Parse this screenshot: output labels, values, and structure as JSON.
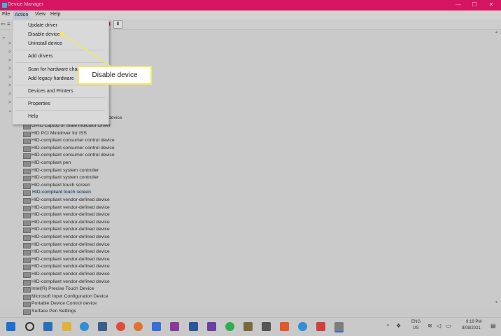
{
  "window": {
    "title": "Device Manager",
    "controls": [
      "—",
      "☐",
      "✕"
    ]
  },
  "menubar": [
    "File",
    "Action",
    "View",
    "Help"
  ],
  "action_menu": {
    "items": [
      "Update driver",
      "Disable device",
      "Uninstall device",
      "Add drivers",
      "Scan for hardware changes",
      "Add legacy hardware",
      "Devices and Printers",
      "Properties",
      "Help"
    ]
  },
  "callout": {
    "text": "Disable device"
  },
  "devices": {
    "partial_top": "device",
    "items": [
      "GPIO Laptop or Slate Indicator Driver",
      "HID PCI Minidriver for ISS",
      "HID-compliant consumer control device",
      "HID-compliant consumer control device",
      "HID-compliant consumer control device",
      "HID-compliant pen",
      "HID-compliant system controller",
      "HID-compliant system controller",
      "HID-compliant touch screen",
      "HID-compliant touch screen",
      "HID-compliant vendor-defined device",
      "HID-compliant vendor-defined device",
      "HID-compliant vendor-defined device",
      "HID-compliant vendor-defined device",
      "HID-compliant vendor-defined device",
      "HID-compliant vendor-defined device",
      "HID-compliant vendor-defined device",
      "HID-compliant vendor-defined device",
      "HID-compliant vendor-defined device",
      "HID-compliant vendor-defined device",
      "HID-compliant vendor-defined device",
      "HID-compliant vendor-defined device",
      "Intel(R) Precise Touch Device",
      "Microsoft Input Configuration Device",
      "Portable Device Control device",
      "Surface Pen Settings"
    ],
    "selected_index": 9
  },
  "tree_markers": [
    ">",
    ">",
    ">",
    ">",
    ">",
    ">",
    ">",
    ">"
  ],
  "tray": {
    "lang_top": "ENG",
    "lang_bottom": "US",
    "time": "9:19 PM",
    "date": "8/08/2021"
  },
  "colors": {
    "titlebar": "#d51462",
    "callout_border": "#f3e766",
    "selection": "#b7c7d6"
  }
}
